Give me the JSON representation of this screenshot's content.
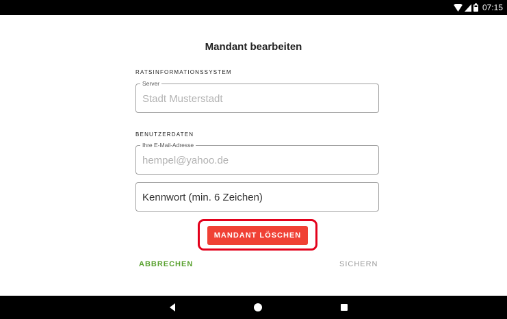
{
  "status_bar": {
    "time": "07:15",
    "icons": [
      "wifi-icon",
      "signal-icon",
      "battery-icon"
    ]
  },
  "dialog": {
    "title": "Mandant bearbeiten"
  },
  "section_ris": {
    "label": "RATSINFORMATIONSSYSTEM",
    "server_field": {
      "label": "Server",
      "value": "Stadt Musterstadt"
    }
  },
  "section_user": {
    "label": "BENUTZERDATEN",
    "email_field": {
      "label": "Ihre E-Mail-Adresse",
      "value": "hempel@yahoo.de"
    },
    "password_field": {
      "placeholder": "Kennwort (min. 6 Zeichen)",
      "value": ""
    }
  },
  "actions": {
    "delete_label": "MANDANT LÖSCHEN",
    "cancel_label": "ABBRECHEN",
    "save_label": "SICHERN"
  },
  "colors": {
    "delete_button": "#f04135",
    "highlight": "#e3001b",
    "cancel_text": "#58a12e",
    "save_text": "#9a9a9a"
  },
  "nav_bar": {
    "icons": [
      "back-icon",
      "home-icon",
      "recent-apps-icon"
    ]
  }
}
